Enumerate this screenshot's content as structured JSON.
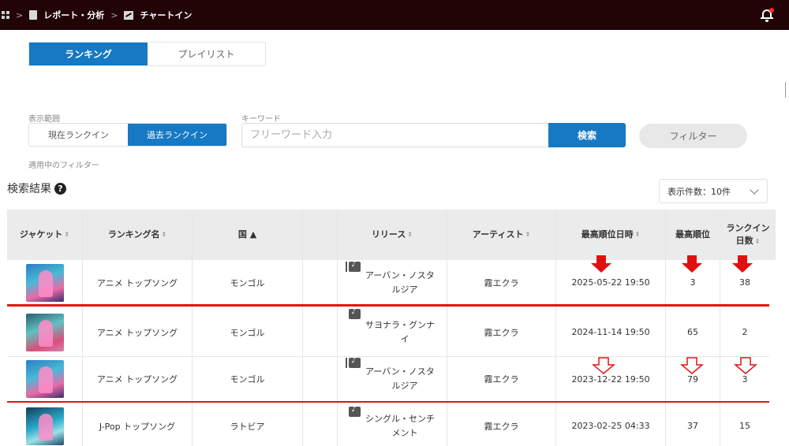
{
  "breadcrumb": {
    "section": "レポート・分析",
    "page": "チャートイン"
  },
  "tabs": [
    {
      "label": "ランキング",
      "active": true
    },
    {
      "label": "プレイリスト",
      "active": false
    }
  ],
  "range": {
    "label": "表示範囲",
    "options": [
      {
        "label": "現在ランクイン",
        "active": false
      },
      {
        "label": "過去ランクイン",
        "active": true
      }
    ]
  },
  "keyword": {
    "label": "キーワード",
    "placeholder": "フリーワード入力",
    "value": ""
  },
  "search_label": "検索",
  "filter_label": "フィルター",
  "applied_filters_label": "適用中のフィルター",
  "results": {
    "title": "検索結果",
    "help_icon": "question-circle-icon"
  },
  "page_size": {
    "label": "表示件数：10件"
  },
  "table": {
    "headers": {
      "jacket": "ジャケット",
      "ranking": "ランキング名",
      "country": "国",
      "country_sort": "▲",
      "release": "リリース",
      "artist": "アーティスト",
      "peak_date": "最高順位日時",
      "peak_rank": "最高順位",
      "days_1": "ランクイン",
      "days_2": "日数"
    },
    "rows": [
      {
        "ranking": "アニメ トップソング",
        "country": "モンゴル",
        "release_type": "album",
        "release_1": "アーバン・ノスタ",
        "release_2": "ルジア",
        "artist": "霧エクラ",
        "peak_date": "2025-05-22 19:50",
        "peak_rank": "3",
        "days": "38"
      },
      {
        "ranking": "アニメ トップソング",
        "country": "モンゴル",
        "release_type": "single",
        "release_1": "サヨナラ・グンナ",
        "release_2": "イ",
        "artist": "霧エクラ",
        "peak_date": "2024-11-14 19:50",
        "peak_rank": "65",
        "days": "2"
      },
      {
        "ranking": "アニメ トップソング",
        "country": "モンゴル",
        "release_type": "album",
        "release_1": "アーバン・ノスタ",
        "release_2": "ルジア",
        "artist": "霧エクラ",
        "peak_date": "2023-12-22 19:50",
        "peak_rank": "79",
        "days": "3"
      },
      {
        "ranking": "J-Pop トップソング",
        "country": "ラトビア",
        "release_type": "single",
        "release_1": "シングル・センチ",
        "release_2": "メント",
        "artist": "霧エクラ",
        "peak_date": "2023-02-25 04:33",
        "peak_rank": "37",
        "days": "15"
      }
    ]
  },
  "annotation_color": "#e01414",
  "accent_color": "#1679c3"
}
